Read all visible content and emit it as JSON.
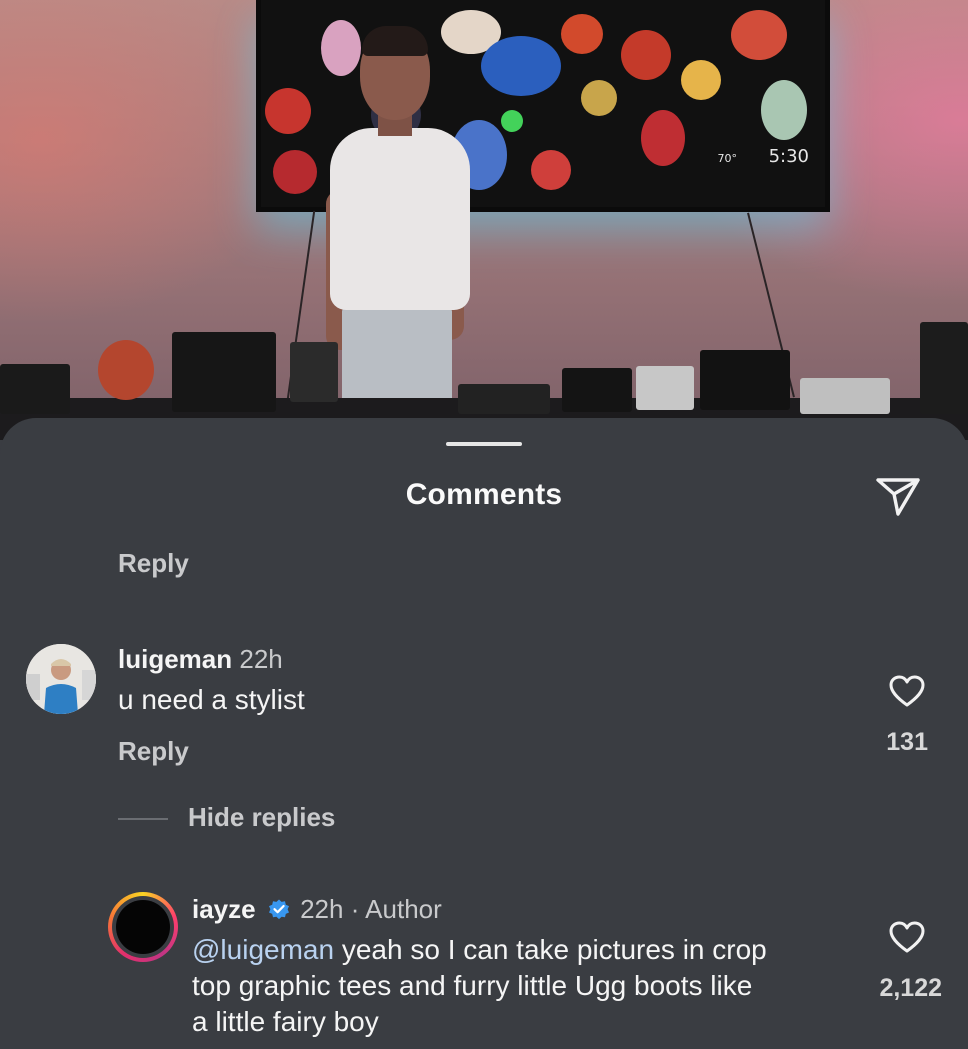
{
  "photo": {
    "tv_temp": "70°",
    "tv_clock": "5:30"
  },
  "sheet": {
    "title": "Comments",
    "share_icon": "paper-plane-icon"
  },
  "comments": [
    {
      "reply_label": "Reply"
    },
    {
      "username": "luigeman",
      "time": "22h",
      "text": "u need a stylist",
      "reply_label": "Reply",
      "likes": "131",
      "heart_icon": "heart-outline-icon"
    }
  ],
  "replies_toggle": {
    "label": "Hide replies"
  },
  "reply": {
    "username": "iayze",
    "verified_icon": "verified-badge-icon",
    "time": "22h",
    "separator": "·",
    "author_label": "Author",
    "mention": "@luigeman",
    "text_line1": " yeah so I can take pictures in crop",
    "text_line2": "top graphic tees and furry little Ugg boots like",
    "text_line3": "a little fairy boy",
    "likes": "2,122",
    "heart_icon": "heart-outline-icon"
  },
  "colors": {
    "sheet_bg": "#3a3d42",
    "mention": "#b9d2f0",
    "verified": "#3897f0"
  }
}
